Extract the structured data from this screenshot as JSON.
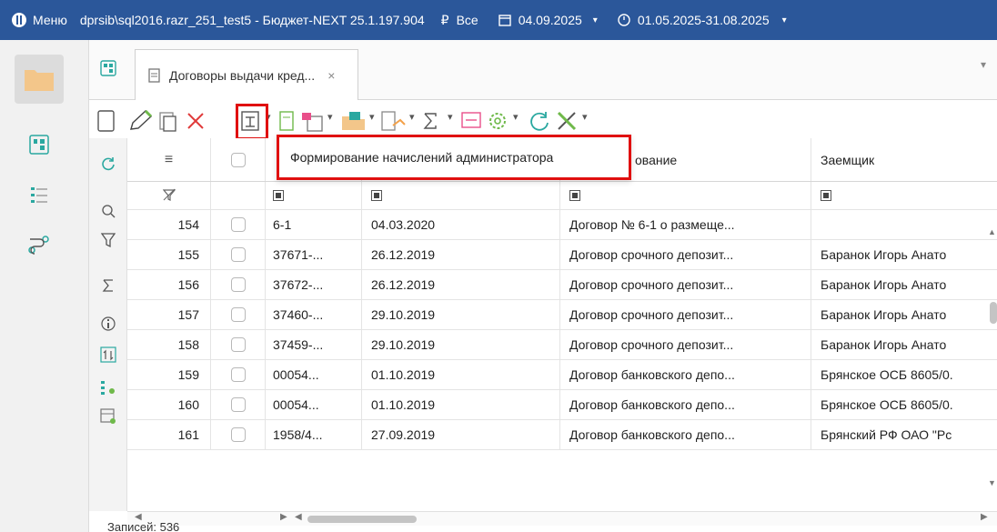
{
  "titlebar": {
    "menu_label": "Меню",
    "window_title": "dprsib\\sql2016.razr_251_test5 - Бюджет-NEXT 25.1.197.904",
    "scope_label": "Все",
    "date_label": "04.09.2025",
    "period_label": "01.05.2025-31.08.2025"
  },
  "tab": {
    "label": "Договоры выдачи кред...",
    "close_glyph": "×"
  },
  "tooltip": {
    "text": "Формирование начислений администратора"
  },
  "grid": {
    "headers": {
      "name_partial": "ование",
      "borrower": "Заемщик"
    },
    "rows": [
      {
        "num": "154",
        "number": "6-1",
        "date": "04.03.2020",
        "name": "Договор № 6-1 о размеще...",
        "borrower": ""
      },
      {
        "num": "155",
        "number": "37671-...",
        "date": "26.12.2019",
        "name": "Договор срочного депозит...",
        "borrower": "Баранок Игорь Анато"
      },
      {
        "num": "156",
        "number": "37672-...",
        "date": "26.12.2019",
        "name": "Договор срочного депозит...",
        "borrower": "Баранок Игорь Анато"
      },
      {
        "num": "157",
        "number": "37460-...",
        "date": "29.10.2019",
        "name": "Договор срочного депозит...",
        "borrower": "Баранок Игорь Анато"
      },
      {
        "num": "158",
        "number": "37459-...",
        "date": "29.10.2019",
        "name": "Договор срочного депозит...",
        "borrower": "Баранок Игорь Анато"
      },
      {
        "num": "159",
        "number": "00054...",
        "date": "01.10.2019",
        "name": "Договор банковского депо...",
        "borrower": "Брянское ОСБ 8605/0."
      },
      {
        "num": "160",
        "number": "00054...",
        "date": "01.10.2019",
        "name": "Договор банковского депо...",
        "borrower": "Брянское ОСБ 8605/0."
      },
      {
        "num": "161",
        "number": "1958/4...",
        "date": "27.09.2019",
        "name": "Договор банковского депо...",
        "borrower": "Брянский РФ ОАО \"Рс"
      }
    ]
  },
  "status": {
    "records_label": "Записей: 536"
  },
  "colors": {
    "titlebar": "#2b579a",
    "highlight": "#e01010",
    "folder": "#f3c68a"
  }
}
